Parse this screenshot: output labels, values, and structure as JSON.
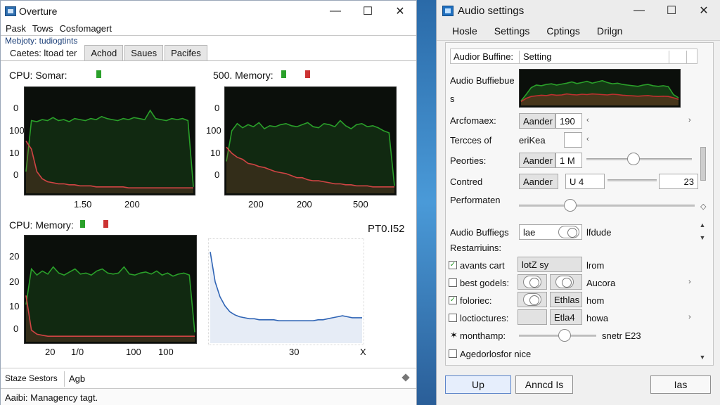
{
  "left_window": {
    "title": "Overture",
    "controls": {
      "minimize": "—",
      "maximize": "☐",
      "close": "✕"
    },
    "menu": [
      "Pask",
      "Tows",
      "Cosfomagert"
    ],
    "subheader": "Mebjoty: tudiogtints",
    "tabs": [
      "Caetes: ltoad ter",
      "Achod",
      "Saues",
      "Pacifes"
    ],
    "charts": [
      {
        "title": "CPU: Somar:",
        "y_ticks": [
          "0",
          "100",
          "10",
          "0"
        ],
        "x_ticks": [
          "1.50",
          "200"
        ],
        "chart_data": {
          "type": "line",
          "series": [
            {
              "color": "#2aa02a",
              "values": [
                20,
                70,
                69,
                71,
                70,
                73,
                70,
                71,
                69,
                72,
                71,
                70,
                72,
                71,
                74,
                72,
                71,
                70,
                72,
                71,
                73,
                72,
                71,
                80,
                72,
                71,
                70,
                72,
                71,
                72,
                70,
                5
              ]
            },
            {
              "color": "#d04444",
              "values": [
                50,
                42,
                20,
                13,
                10,
                9,
                8,
                8,
                7,
                7,
                6,
                6,
                6,
                5,
                5,
                5,
                5,
                5,
                5,
                4,
                4,
                4,
                4,
                4,
                4,
                4,
                4,
                4,
                4,
                4,
                4,
                4
              ]
            }
          ]
        }
      },
      {
        "title": "500. Memory:",
        "y_ticks": [
          "0",
          "100",
          "10",
          "0"
        ],
        "x_ticks": [
          "200",
          "200",
          "500"
        ],
        "chart_data": {
          "type": "line",
          "series": [
            {
              "color": "#2aa02a",
              "values": [
                30,
                60,
                67,
                63,
                66,
                64,
                68,
                62,
                65,
                64,
                66,
                67,
                65,
                64,
                66,
                68,
                64,
                63,
                67,
                66,
                64,
                70,
                65,
                62,
                66,
                67,
                64,
                65,
                63,
                60,
                58,
                6
              ]
            },
            {
              "color": "#d04444",
              "values": [
                44,
                38,
                34,
                32,
                28,
                27,
                25,
                24,
                22,
                20,
                19,
                18,
                16,
                14,
                14,
                12,
                11,
                11,
                10,
                9,
                8,
                8,
                7,
                7,
                6,
                6,
                6,
                5,
                5,
                5,
                5,
                5
              ]
            }
          ]
        }
      },
      {
        "title": "CPU: Memory:",
        "y_ticks": [
          "20",
          "20",
          "10",
          "0"
        ],
        "x_ticks": [
          "20",
          "1/0",
          "100",
          "100"
        ],
        "chart_data": {
          "type": "line",
          "series": [
            {
              "color": "#2aa02a",
              "values": [
                35,
                70,
                64,
                68,
                65,
                72,
                66,
                64,
                67,
                70,
                65,
                66,
                64,
                68,
                70,
                66,
                65,
                66,
                72,
                65,
                64,
                66,
                67,
                65,
                68,
                64,
                66,
                63,
                65,
                66,
                64,
                8
              ]
            },
            {
              "color": "#d04444",
              "values": [
                44,
                10,
                6,
                5,
                4,
                4,
                4,
                4,
                4,
                4,
                4,
                4,
                4,
                4,
                4,
                4,
                4,
                4,
                4,
                4,
                4,
                4,
                4,
                4,
                4,
                4,
                4,
                4,
                4,
                4,
                4,
                4
              ]
            }
          ]
        }
      },
      {
        "title": "PT0.I52",
        "x_ticks": [
          "30",
          "X"
        ],
        "chart_data": {
          "type": "area",
          "series": [
            {
              "color": "#2f64b5",
              "values": [
                90,
                60,
                45,
                36,
                30,
                27,
                25,
                24,
                23,
                23,
                22,
                22,
                22,
                22,
                21,
                21,
                21,
                21,
                21,
                21,
                21,
                21,
                22,
                22,
                23,
                24,
                25,
                26,
                25,
                24,
                24,
                24
              ]
            }
          ]
        }
      }
    ],
    "status_tab1": "Staze Sestors",
    "status_tab2": "Agb",
    "bottom_text": "Aaibi: Managency tagt."
  },
  "right_window": {
    "title": "Audio settings",
    "controls": {
      "minimize": "—",
      "maximize": "☐",
      "close": "✕"
    },
    "menu": [
      "Hosle",
      "Settings",
      "Cptings",
      "Drilgn"
    ],
    "panel_header": {
      "col1": "Audior Buffine:",
      "col2": "Setting"
    },
    "preview_label": "Audio Buffiebue",
    "preview_label2": "s",
    "preview_chart_data": {
      "type": "area",
      "series": [
        {
          "color": "#2aa02a",
          "values": [
            10,
            30,
            52,
            60,
            58,
            62,
            64,
            60,
            63,
            66,
            70,
            65,
            68,
            72,
            66,
            70,
            74,
            68,
            64,
            66,
            62,
            60,
            58,
            56,
            60,
            62,
            58,
            56,
            58,
            55,
            30,
            20
          ]
        },
        {
          "color": "#c03030",
          "values": [
            8,
            18,
            24,
            26,
            28,
            27,
            30,
            28,
            29,
            32,
            30,
            29,
            31,
            30,
            32,
            31,
            30,
            29,
            31,
            30,
            28,
            27,
            26,
            25,
            26,
            27,
            25,
            24,
            25,
            24,
            20,
            15
          ]
        }
      ]
    },
    "rows": {
      "arcfomaex": {
        "label": "Arcfomaex:",
        "btn": "Aander",
        "val": "190"
      },
      "tercces": {
        "label": "Tercces of",
        "val": "eriKea"
      },
      "peorties": {
        "label": "Peorties:",
        "btn": "Aander",
        "val": "1 M"
      },
      "contred": {
        "label": "Contred",
        "btn": "Aander",
        "val": "U 4",
        "right_val": "23"
      },
      "performation": {
        "label": "Performaten"
      },
      "audio_buffiegs": {
        "label": "Audio Buffiegs",
        "toggle_text": "lae",
        "right": "lfdude"
      },
      "restarrunns": {
        "label": "Restarriuins:"
      },
      "avants": {
        "label": "avants cart",
        "val": "lotZ sy",
        "right": "lrom"
      },
      "best_godets": {
        "label": "best godels:",
        "right": "Aucora"
      },
      "foloric": {
        "label": "foloriec:",
        "val": "Ethlas",
        "right": "hom"
      },
      "loctioctures": {
        "label": "loctioctures:",
        "val": "Etla4",
        "right": "howa"
      },
      "monthamp": {
        "label": "monthamp:",
        "right": "snetr E23"
      },
      "agendor": {
        "label": "Agedorlosfor nice"
      }
    },
    "footer": {
      "ok": "Up",
      "apply": "Anncd Is",
      "cancel": "Ias"
    }
  }
}
